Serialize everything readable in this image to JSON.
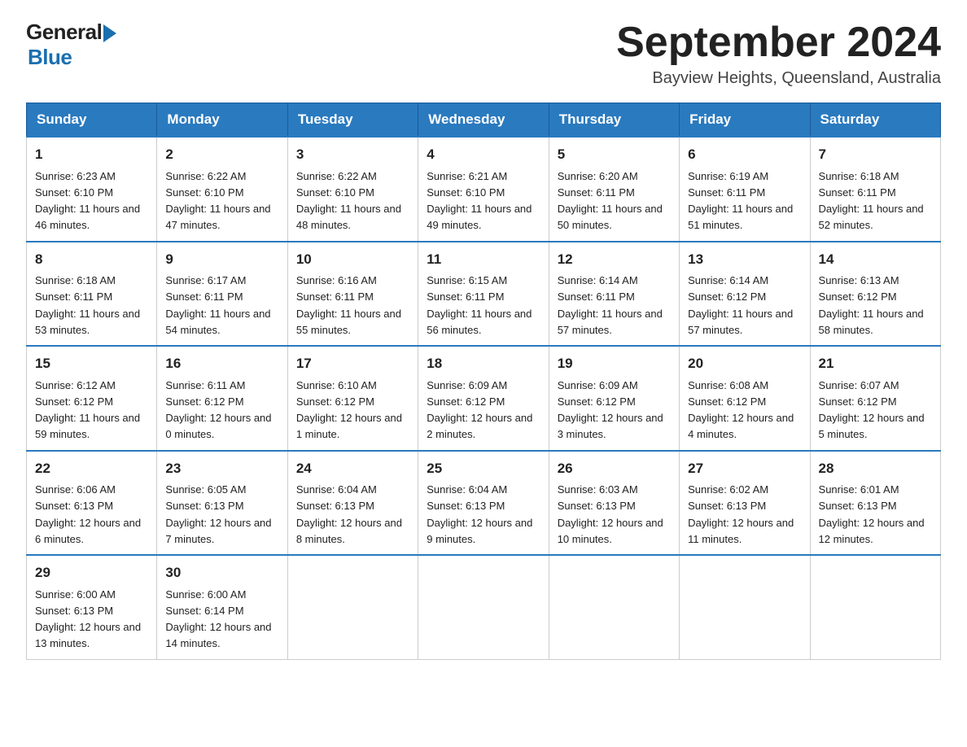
{
  "header": {
    "logo_general": "General",
    "logo_blue": "Blue",
    "title": "September 2024",
    "location": "Bayview Heights, Queensland, Australia"
  },
  "calendar": {
    "days_of_week": [
      "Sunday",
      "Monday",
      "Tuesday",
      "Wednesday",
      "Thursday",
      "Friday",
      "Saturday"
    ],
    "weeks": [
      [
        {
          "day": "1",
          "sunrise": "6:23 AM",
          "sunset": "6:10 PM",
          "daylight": "11 hours and 46 minutes."
        },
        {
          "day": "2",
          "sunrise": "6:22 AM",
          "sunset": "6:10 PM",
          "daylight": "11 hours and 47 minutes."
        },
        {
          "day": "3",
          "sunrise": "6:22 AM",
          "sunset": "6:10 PM",
          "daylight": "11 hours and 48 minutes."
        },
        {
          "day": "4",
          "sunrise": "6:21 AM",
          "sunset": "6:10 PM",
          "daylight": "11 hours and 49 minutes."
        },
        {
          "day": "5",
          "sunrise": "6:20 AM",
          "sunset": "6:11 PM",
          "daylight": "11 hours and 50 minutes."
        },
        {
          "day": "6",
          "sunrise": "6:19 AM",
          "sunset": "6:11 PM",
          "daylight": "11 hours and 51 minutes."
        },
        {
          "day": "7",
          "sunrise": "6:18 AM",
          "sunset": "6:11 PM",
          "daylight": "11 hours and 52 minutes."
        }
      ],
      [
        {
          "day": "8",
          "sunrise": "6:18 AM",
          "sunset": "6:11 PM",
          "daylight": "11 hours and 53 minutes."
        },
        {
          "day": "9",
          "sunrise": "6:17 AM",
          "sunset": "6:11 PM",
          "daylight": "11 hours and 54 minutes."
        },
        {
          "day": "10",
          "sunrise": "6:16 AM",
          "sunset": "6:11 PM",
          "daylight": "11 hours and 55 minutes."
        },
        {
          "day": "11",
          "sunrise": "6:15 AM",
          "sunset": "6:11 PM",
          "daylight": "11 hours and 56 minutes."
        },
        {
          "day": "12",
          "sunrise": "6:14 AM",
          "sunset": "6:11 PM",
          "daylight": "11 hours and 57 minutes."
        },
        {
          "day": "13",
          "sunrise": "6:14 AM",
          "sunset": "6:12 PM",
          "daylight": "11 hours and 57 minutes."
        },
        {
          "day": "14",
          "sunrise": "6:13 AM",
          "sunset": "6:12 PM",
          "daylight": "11 hours and 58 minutes."
        }
      ],
      [
        {
          "day": "15",
          "sunrise": "6:12 AM",
          "sunset": "6:12 PM",
          "daylight": "11 hours and 59 minutes."
        },
        {
          "day": "16",
          "sunrise": "6:11 AM",
          "sunset": "6:12 PM",
          "daylight": "12 hours and 0 minutes."
        },
        {
          "day": "17",
          "sunrise": "6:10 AM",
          "sunset": "6:12 PM",
          "daylight": "12 hours and 1 minute."
        },
        {
          "day": "18",
          "sunrise": "6:09 AM",
          "sunset": "6:12 PM",
          "daylight": "12 hours and 2 minutes."
        },
        {
          "day": "19",
          "sunrise": "6:09 AM",
          "sunset": "6:12 PM",
          "daylight": "12 hours and 3 minutes."
        },
        {
          "day": "20",
          "sunrise": "6:08 AM",
          "sunset": "6:12 PM",
          "daylight": "12 hours and 4 minutes."
        },
        {
          "day": "21",
          "sunrise": "6:07 AM",
          "sunset": "6:12 PM",
          "daylight": "12 hours and 5 minutes."
        }
      ],
      [
        {
          "day": "22",
          "sunrise": "6:06 AM",
          "sunset": "6:13 PM",
          "daylight": "12 hours and 6 minutes."
        },
        {
          "day": "23",
          "sunrise": "6:05 AM",
          "sunset": "6:13 PM",
          "daylight": "12 hours and 7 minutes."
        },
        {
          "day": "24",
          "sunrise": "6:04 AM",
          "sunset": "6:13 PM",
          "daylight": "12 hours and 8 minutes."
        },
        {
          "day": "25",
          "sunrise": "6:04 AM",
          "sunset": "6:13 PM",
          "daylight": "12 hours and 9 minutes."
        },
        {
          "day": "26",
          "sunrise": "6:03 AM",
          "sunset": "6:13 PM",
          "daylight": "12 hours and 10 minutes."
        },
        {
          "day": "27",
          "sunrise": "6:02 AM",
          "sunset": "6:13 PM",
          "daylight": "12 hours and 11 minutes."
        },
        {
          "day": "28",
          "sunrise": "6:01 AM",
          "sunset": "6:13 PM",
          "daylight": "12 hours and 12 minutes."
        }
      ],
      [
        {
          "day": "29",
          "sunrise": "6:00 AM",
          "sunset": "6:13 PM",
          "daylight": "12 hours and 13 minutes."
        },
        {
          "day": "30",
          "sunrise": "6:00 AM",
          "sunset": "6:14 PM",
          "daylight": "12 hours and 14 minutes."
        },
        null,
        null,
        null,
        null,
        null
      ]
    ]
  }
}
